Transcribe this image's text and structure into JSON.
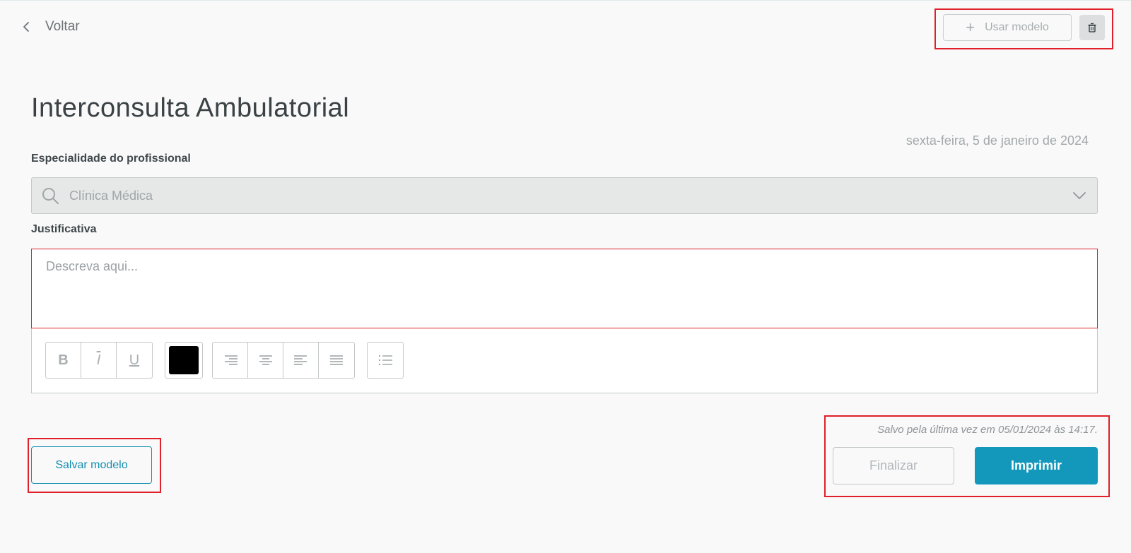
{
  "nav": {
    "back_label": "Voltar"
  },
  "toolbar_top": {
    "use_template_label": "Usar modelo"
  },
  "page": {
    "title": "Interconsulta Ambulatorial",
    "date": "sexta-feira, 5 de janeiro de 2024"
  },
  "specialty": {
    "label": "Especialidade do profissional",
    "value": "Clínica Médica"
  },
  "justification": {
    "label": "Justificativa",
    "placeholder": "Descreva aqui..."
  },
  "editor_toolbar": {
    "bold": "B",
    "italic": "I",
    "underline": "U",
    "text_color": "#000000"
  },
  "footer": {
    "saved_note": "Salvo pela última vez em 05/01/2024 às 14:17.",
    "save_template_label": "Salvar modelo",
    "finalize_label": "Finalizar",
    "print_label": "Imprimir"
  },
  "colors": {
    "accent": "#1398bc",
    "highlight_border": "#e0202a",
    "error_border": "#d9232b"
  }
}
